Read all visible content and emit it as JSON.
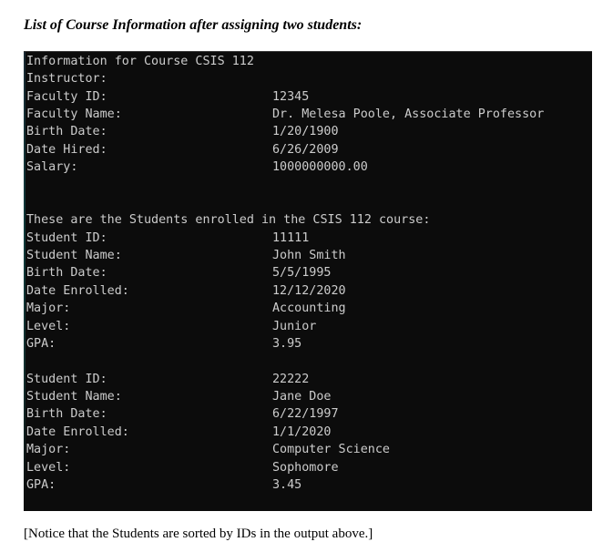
{
  "heading": "List of Course Information after assigning two students:",
  "console": {
    "course_header": "Information for Course CSIS 112",
    "instructor_label": "Instructor:",
    "instructor": {
      "fields": [
        {
          "label": "Faculty ID:",
          "value": "12345"
        },
        {
          "label": "Faculty Name:",
          "value": "Dr. Melesa Poole, Associate Professor"
        },
        {
          "label": "Birth Date:",
          "value": "1/20/1900"
        },
        {
          "label": "Date Hired:",
          "value": "6/26/2009"
        },
        {
          "label": "Salary:",
          "value": "1000000000.00"
        }
      ]
    },
    "students_header": "These are the Students enrolled in the CSIS 112 course:",
    "students": [
      {
        "fields": [
          {
            "label": "Student ID:",
            "value": "11111"
          },
          {
            "label": "Student Name:",
            "value": "John Smith"
          },
          {
            "label": "Birth Date:",
            "value": "5/5/1995"
          },
          {
            "label": "Date Enrolled:",
            "value": "12/12/2020"
          },
          {
            "label": "Major:",
            "value": "Accounting"
          },
          {
            "label": "Level:",
            "value": "Junior"
          },
          {
            "label": "GPA:",
            "value": "3.95"
          }
        ]
      },
      {
        "fields": [
          {
            "label": "Student ID:",
            "value": "22222"
          },
          {
            "label": "Student Name:",
            "value": "Jane Doe"
          },
          {
            "label": "Birth Date:",
            "value": "6/22/1997"
          },
          {
            "label": "Date Enrolled:",
            "value": "1/1/2020"
          },
          {
            "label": "Major:",
            "value": "Computer Science"
          },
          {
            "label": "Level:",
            "value": "Sophomore"
          },
          {
            "label": "GPA:",
            "value": "3.45"
          }
        ]
      }
    ]
  },
  "footnote": "[Notice that the Students are sorted by IDs in the output above.]"
}
